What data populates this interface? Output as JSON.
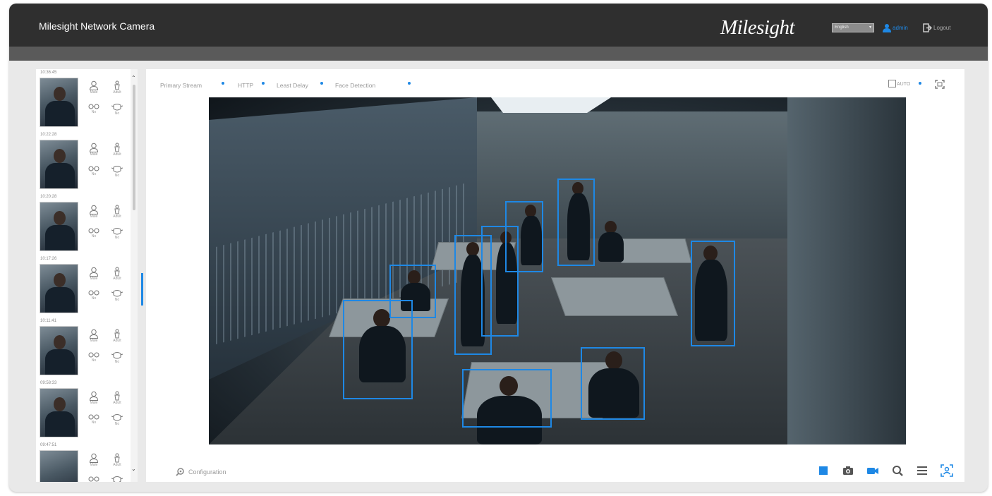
{
  "header": {
    "title": "Milesight Network Camera",
    "brand": "Milesight",
    "language": "English",
    "user": "admin",
    "logout": "Logout"
  },
  "sidebar": {
    "captures": [
      {
        "time": "10:36:45",
        "attrs": [
          "Male",
          "Adult",
          "No",
          "No"
        ]
      },
      {
        "time": "10:22:28",
        "attrs": [
          "Male",
          "Adult",
          "No",
          "No"
        ]
      },
      {
        "time": "10:20:28",
        "attrs": [
          "Male",
          "Adult",
          "No",
          "No"
        ]
      },
      {
        "time": "10:17:26",
        "attrs": [
          "Male",
          "Adult",
          "No",
          "No"
        ]
      },
      {
        "time": "10:11:41",
        "attrs": [
          "Male",
          "Adult",
          "No",
          "No"
        ]
      },
      {
        "time": "09:58:33",
        "attrs": [
          "Male",
          "Adult",
          "No",
          "No"
        ]
      },
      {
        "time": "09:47:51",
        "attrs": [
          "Male",
          "Adult",
          "No",
          "No"
        ]
      }
    ]
  },
  "toolbar": {
    "stream": "Primary Stream",
    "protocol": "HTTP",
    "delay": "Least Delay",
    "mode": "Face Detection",
    "scale": "AUTO",
    "configuration": "Configuration"
  },
  "colors": {
    "accent": "#1e88e5",
    "header_bg": "#2f2f2f",
    "subbar_bg": "#5a5a5a"
  }
}
